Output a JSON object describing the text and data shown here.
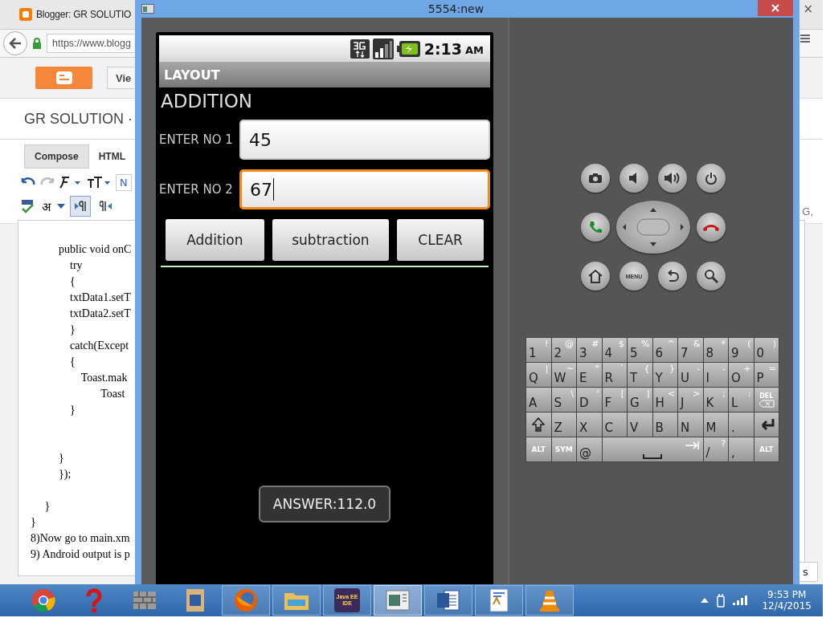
{
  "browser": {
    "tab_title": "Blogger: GR SOLUTIO",
    "url": "https://www.blogg",
    "view_button": "Vie",
    "blog_title": "GR SOLUTION ·",
    "editor_tabs": [
      {
        "label": "Compose",
        "selected": true
      },
      {
        "label": "HTML",
        "selected": false
      }
    ],
    "font_field": "N",
    "script_button": "अ",
    "direction_buttons": [
      {
        "kind": "ltr",
        "selected": true
      },
      {
        "kind": "rtl",
        "selected": false
      }
    ],
    "code_blocks": [
      [
        "          public void onC",
        "              try",
        "              {",
        "              txtData1.setT",
        "              txtData2.setT",
        "              }",
        "              catch(Except",
        "              {",
        "                  Toast.mak",
        "                         Toast",
        "              }"
      ],
      [
        "          }",
        "          });"
      ],
      [
        "     }",
        "}",
        "8)Now go to main.xm",
        "9) Android output is p"
      ]
    ],
    "side_text": "G,",
    "popup_text": "s",
    "close_mark": "×"
  },
  "emulator": {
    "title": "5554:new",
    "status_bar": {
      "time": "2:13",
      "ampm": "AM"
    },
    "app_title": "LAYOUT",
    "heading": "ADDITION",
    "fields": [
      {
        "label": "ENTER NO 1",
        "value": "45",
        "focused": false
      },
      {
        "label": "ENTER NO 2",
        "value": "67",
        "focused": true
      }
    ],
    "buttons": [
      "Addition",
      "subtraction",
      "CLEAR"
    ],
    "toast": "ANSWER:112.0",
    "hardware_buttons": [
      {
        "kind": "camera"
      },
      {
        "kind": "volume-down"
      },
      {
        "kind": "volume-up"
      },
      {
        "kind": "power"
      },
      {
        "kind": "call"
      },
      {
        "kind": "dpad"
      },
      {
        "kind": "end-call"
      },
      {
        "kind": "home"
      },
      {
        "kind": "menu",
        "label": "MENU"
      },
      {
        "kind": "back"
      },
      {
        "kind": "search"
      }
    ],
    "keyboard": [
      [
        {
          "main": "1",
          "alt": "!"
        },
        {
          "main": "2",
          "alt": "@"
        },
        {
          "main": "3",
          "alt": "#"
        },
        {
          "main": "4",
          "alt": "$"
        },
        {
          "main": "5",
          "alt": "%"
        },
        {
          "main": "6",
          "alt": "^"
        },
        {
          "main": "7",
          "alt": "&"
        },
        {
          "main": "8",
          "alt": "*"
        },
        {
          "main": "9",
          "alt": "("
        },
        {
          "main": "0",
          "alt": ")"
        }
      ],
      [
        {
          "main": "Q",
          "alt": "|"
        },
        {
          "main": "W",
          "alt": "~"
        },
        {
          "main": "E",
          "alt": "\""
        },
        {
          "main": "R",
          "alt": "`"
        },
        {
          "main": "T",
          "alt": "{"
        },
        {
          "main": "Y",
          "alt": "}"
        },
        {
          "main": "U",
          "alt": "-"
        },
        {
          "main": "I",
          "alt": "-"
        },
        {
          "main": "O",
          "alt": "+"
        },
        {
          "main": "P",
          "alt": "="
        }
      ],
      [
        {
          "main": "A"
        },
        {
          "main": "S",
          "alt": "\\"
        },
        {
          "main": "D",
          "alt": "'"
        },
        {
          "main": "F",
          "alt": "["
        },
        {
          "main": "G",
          "alt": "]"
        },
        {
          "main": "H",
          "alt": "<"
        },
        {
          "main": "J",
          "alt": ">"
        },
        {
          "main": "K",
          "alt": ";"
        },
        {
          "main": "L",
          "alt": ":"
        },
        {
          "kind": "del",
          "main": "DEL"
        }
      ],
      [
        {
          "kind": "shift"
        },
        {
          "main": "Z"
        },
        {
          "main": "X"
        },
        {
          "main": "C"
        },
        {
          "main": "V"
        },
        {
          "main": "B"
        },
        {
          "main": "N"
        },
        {
          "main": "M"
        },
        {
          "main": "."
        },
        {
          "kind": "enter"
        }
      ],
      [
        {
          "kind": "mod",
          "main": "ALT"
        },
        {
          "kind": "mod",
          "main": "SYM"
        },
        {
          "main": "@"
        },
        {
          "kind": "space"
        },
        {
          "main": "/",
          "alt": "?"
        },
        {
          "main": ","
        },
        {
          "kind": "mod",
          "main": "ALT"
        }
      ]
    ]
  },
  "taskbar": {
    "apps": [
      {
        "kind": "chrome",
        "running": false,
        "selected": false
      },
      {
        "kind": "help",
        "running": false,
        "selected": false
      },
      {
        "kind": "bricks",
        "running": false,
        "selected": false
      },
      {
        "kind": "wordpad-w",
        "running": false,
        "selected": false
      },
      {
        "kind": "firefox",
        "running": true,
        "selected": false
      },
      {
        "kind": "folder",
        "running": true,
        "selected": false
      },
      {
        "kind": "ide",
        "label": "Java EE IDE",
        "running": true,
        "selected": false
      },
      {
        "kind": "emulator",
        "running": true,
        "selected": true
      },
      {
        "kind": "word",
        "running": true,
        "selected": false
      },
      {
        "kind": "document",
        "running": true,
        "selected": false
      },
      {
        "kind": "vlc",
        "running": true,
        "selected": false
      }
    ],
    "time": "9:53 PM",
    "date": "12/4/2015"
  }
}
